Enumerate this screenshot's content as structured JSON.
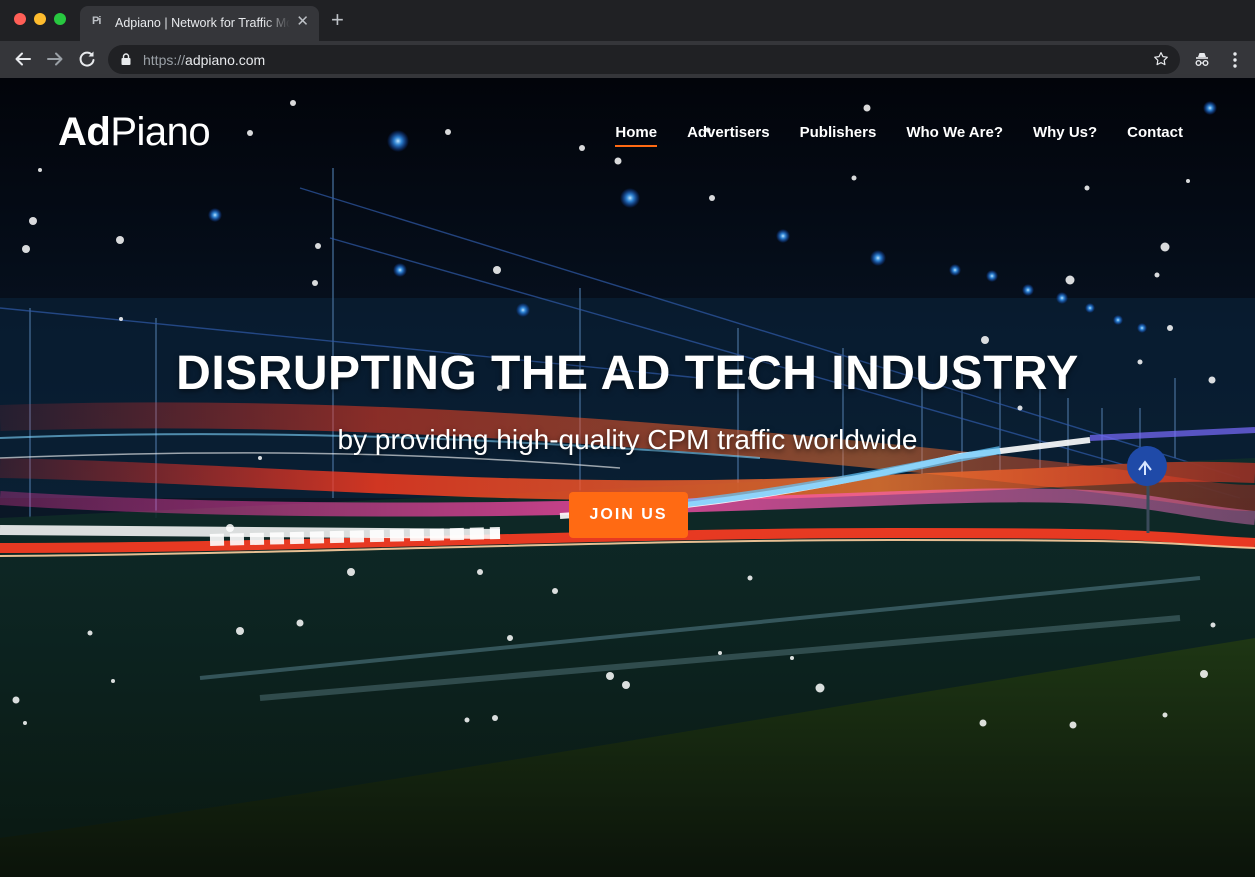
{
  "browser": {
    "tab": {
      "favicon": "Pi",
      "title": "Adpiano | Network for Traffic Monetization",
      "close_symbol": "✕"
    },
    "new_tab_symbol": "+",
    "address": {
      "scheme": "https://",
      "host": "adpiano.com"
    }
  },
  "site": {
    "logo": {
      "part1": "Ad",
      "part2": "Piano"
    },
    "nav": [
      {
        "label": "Home",
        "active": true
      },
      {
        "label": "Advertisers",
        "active": false
      },
      {
        "label": "Publishers",
        "active": false
      },
      {
        "label": "Who We Are?",
        "active": false
      },
      {
        "label": "Why Us?",
        "active": false
      },
      {
        "label": "Contact",
        "active": false
      }
    ],
    "hero": {
      "title": "DISRUPTING THE AD TECH INDUSTRY",
      "subtitle": "by providing high-quality CPM traffic worldwide",
      "cta_label": "JOIN US"
    }
  },
  "colors": {
    "accent": "#ff6a13",
    "chrome_dark": "#202124",
    "chrome_toolbar": "#35363a"
  },
  "icons": {
    "back": "arrow-left-icon",
    "forward": "arrow-right-icon",
    "reload": "reload-icon",
    "lock": "lock-icon",
    "bookmark": "star-icon",
    "incognito": "incognito-icon",
    "menu": "kebab-menu-icon"
  }
}
